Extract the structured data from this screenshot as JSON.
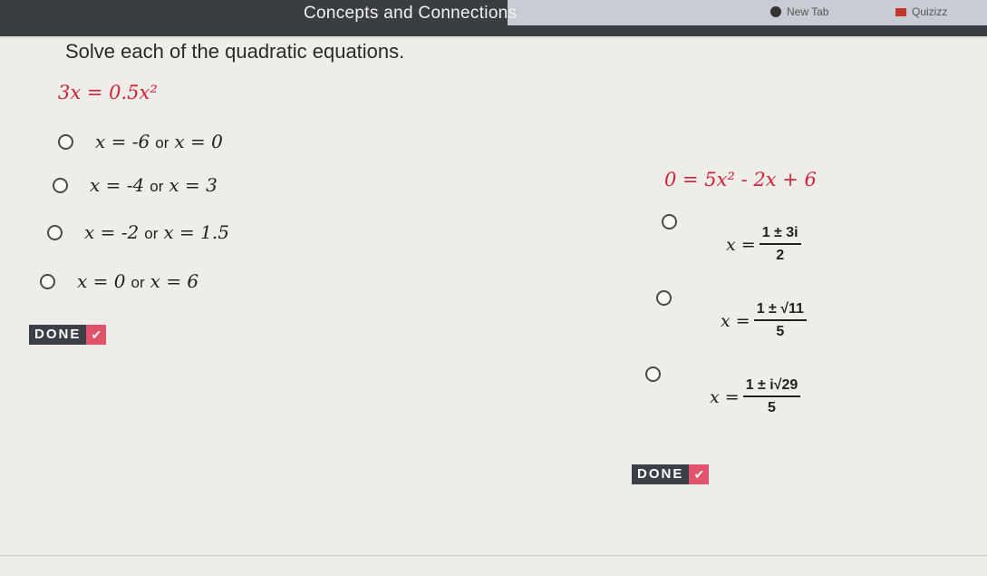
{
  "browser": {
    "tabs": [
      {
        "label": "New Tab"
      },
      {
        "label": "Quizizz"
      }
    ]
  },
  "header": {
    "title": "Concepts and Connections"
  },
  "instructions": "Solve each of the quadratic equations.",
  "problem1": {
    "equation": "3x = 0.5x²",
    "options": [
      {
        "a": "x = -6",
        "or": "or",
        "b": "x = 0"
      },
      {
        "a": "x = -4",
        "or": "or",
        "b": "x = 3"
      },
      {
        "a": "x = -2",
        "or": "or",
        "b": "x = 1.5"
      },
      {
        "a": "x = 0",
        "or": "or",
        "b": "x = 6"
      }
    ],
    "done_label": "DONE",
    "done_icon": "check-icon"
  },
  "problem2": {
    "equation": "0 = 5x² - 2x + 6",
    "options": [
      {
        "lhs": "x =",
        "num": "1 ± 3i",
        "den": "2"
      },
      {
        "lhs": "x =",
        "num": "1 ± √11",
        "den": "5"
      },
      {
        "lhs": "x =",
        "num": "1 ± i√29",
        "den": "5"
      }
    ],
    "done_label": "DONE",
    "done_icon": "check-icon"
  },
  "colors": {
    "equation_red": "#d2233a",
    "done_dark": "#3b3f46",
    "done_check": "#e0536a"
  }
}
